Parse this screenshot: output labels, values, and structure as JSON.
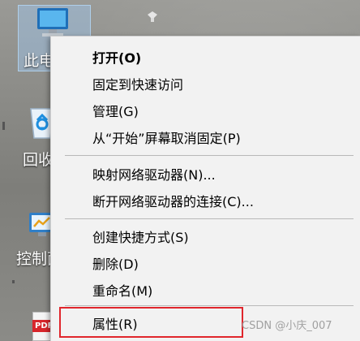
{
  "desktop_icons": {
    "this_pc": "此电",
    "recycle_bin": "回收",
    "control_panel": "控制面",
    "pdf_badge": "PDF"
  },
  "menu": {
    "items": [
      {
        "label": "打开(O)",
        "bold": true
      },
      {
        "label": "固定到快速访问"
      },
      {
        "label": "管理(G)"
      },
      {
        "label": "从“开始”屏幕取消固定(P)"
      },
      {
        "label": "映射网络驱动器(N)..."
      },
      {
        "label": "断开网络驱动器的连接(C)..."
      },
      {
        "label": "创建快捷方式(S)"
      },
      {
        "label": "删除(D)"
      },
      {
        "label": "重命名(M)"
      },
      {
        "label": "属性(R)"
      }
    ]
  },
  "watermark": "CSDN @小庆_007",
  "colors": {
    "highlight_border": "#e0262c",
    "menu_background": "#f2f2f2"
  }
}
